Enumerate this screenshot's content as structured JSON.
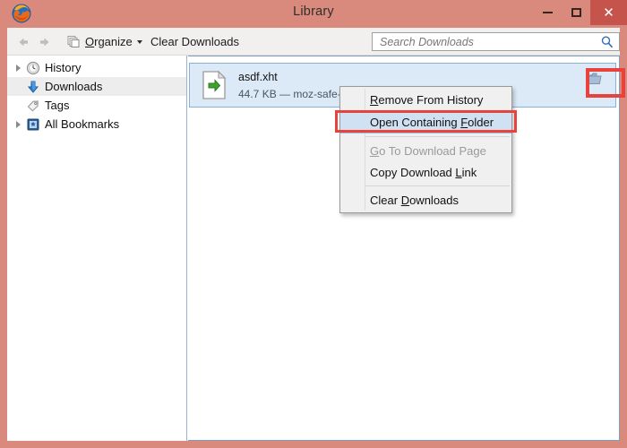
{
  "window": {
    "title": "Library",
    "frame_color": "#d98a7c",
    "close_button_color": "#c4544c",
    "controls": {
      "minimize_label": "–",
      "maximize_label": "□",
      "close_label": "✕"
    }
  },
  "toolbar": {
    "back_label": "Back",
    "forward_label": "Forward",
    "organize": {
      "label": "Organize",
      "accel": "O",
      "before": "",
      "after": "rganize"
    },
    "clear_downloads_label": "Clear Downloads",
    "search": {
      "placeholder": "Search Downloads",
      "value": ""
    }
  },
  "sidebar": {
    "items": [
      {
        "label": "History",
        "icon": "clock-icon",
        "expandable": true,
        "selected": false
      },
      {
        "label": "Downloads",
        "icon": "download-arrow-icon",
        "expandable": false,
        "selected": true
      },
      {
        "label": "Tags",
        "icon": "tag-icon",
        "expandable": false,
        "selected": false
      },
      {
        "label": "All Bookmarks",
        "icon": "bookmarks-book-icon",
        "expandable": true,
        "selected": false
      }
    ]
  },
  "downloads": {
    "rows": [
      {
        "filename": "asdf.xht",
        "detail": "44.7 KB — moz-safe-ab",
        "icon": "document-download-icon",
        "action_icon": "folder-icon",
        "selected": true
      }
    ]
  },
  "context_menu": {
    "items": [
      {
        "label": "Remove From History",
        "accel": "R",
        "pre": "",
        "post": "emove From History",
        "disabled": false,
        "highlighted": false
      },
      {
        "label": "Open Containing Folder",
        "accel": "F",
        "pre": "Open Containing ",
        "post": "older",
        "disabled": false,
        "highlighted": true
      },
      {
        "separator_after": false,
        "label": "Go To Download Page",
        "accel": "G",
        "pre": "",
        "post": "o To Download Page",
        "disabled": true,
        "highlighted": false
      },
      {
        "label": "Copy Download Link",
        "accel": "L",
        "pre": "Copy Download ",
        "post": "ink",
        "disabled": false,
        "highlighted": false
      },
      {
        "label": "Clear Downloads",
        "accel": "D",
        "pre": "Clear ",
        "post": "ownloads",
        "disabled": false,
        "highlighted": false
      }
    ]
  },
  "annotations": {
    "highlight_color": "#e8423c",
    "targets": [
      "folder-button",
      "open-containing-folder-menu-item"
    ]
  }
}
